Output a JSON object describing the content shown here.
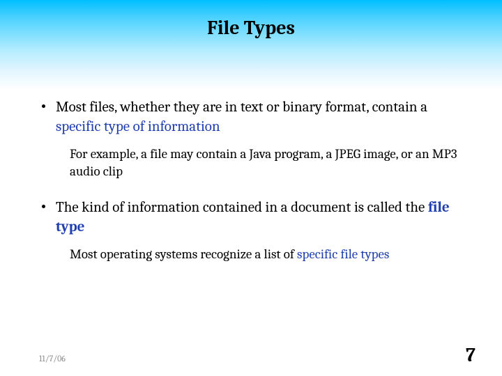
{
  "title": "File Types",
  "bullets": [
    {
      "main_pre": "Most files, whether they are in text or binary format, contain a ",
      "main_accent": "specific type of information",
      "main_post": "",
      "sub_pre": "For example, a file may contain a Java program, a JPEG image, or an MP3 audio clip",
      "sub_accent": "",
      "sub_post": ""
    },
    {
      "main_pre": "The kind of information contained in a document is called the ",
      "main_accent": "file type",
      "main_accent_bold": true,
      "main_post": "",
      "sub_pre": "Most operating systems recognize a list of ",
      "sub_accent": "specific file types",
      "sub_post": ""
    }
  ],
  "footer": {
    "date": "11/7/06",
    "page": "7"
  }
}
